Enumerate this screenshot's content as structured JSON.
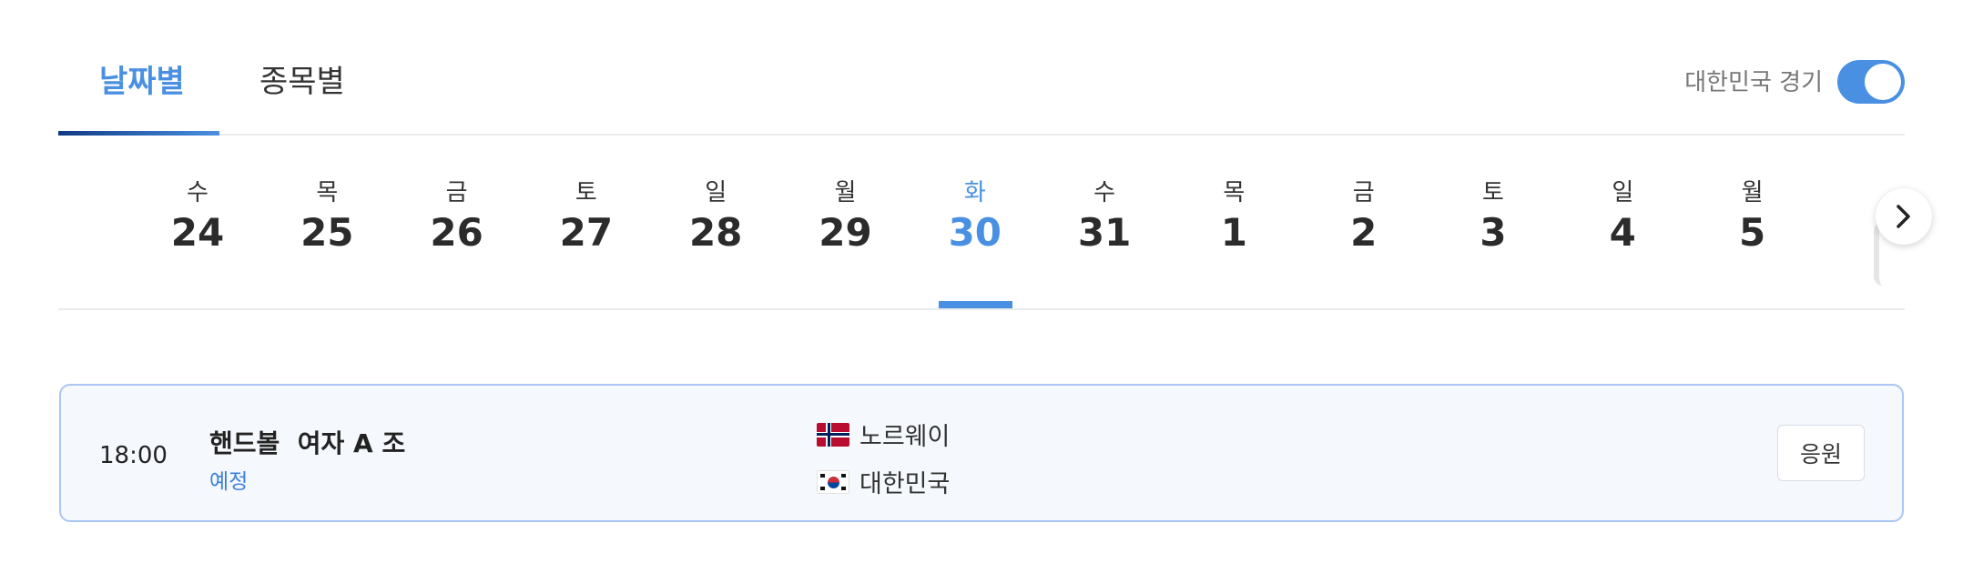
{
  "tabs": [
    {
      "label": "날짜별",
      "active": true
    },
    {
      "label": "종목별",
      "active": false
    }
  ],
  "korea_filter": {
    "label": "대한민국 경기",
    "enabled": true
  },
  "dates": [
    {
      "dow": "수",
      "day": "24"
    },
    {
      "dow": "목",
      "day": "25"
    },
    {
      "dow": "금",
      "day": "26"
    },
    {
      "dow": "토",
      "day": "27"
    },
    {
      "dow": "일",
      "day": "28"
    },
    {
      "dow": "월",
      "day": "29"
    },
    {
      "dow": "화",
      "day": "30",
      "selected": true
    },
    {
      "dow": "수",
      "day": "31"
    },
    {
      "dow": "목",
      "day": "1"
    },
    {
      "dow": "금",
      "day": "2"
    },
    {
      "dow": "토",
      "day": "3"
    },
    {
      "dow": "일",
      "day": "4"
    },
    {
      "dow": "월",
      "day": "5"
    }
  ],
  "next_icon": "chevron-right-icon",
  "colors": {
    "accent": "#4a90e2",
    "accent_dark": "#0f3a83",
    "card_bg": "#f5f8fd",
    "card_border": "#aac6f2"
  },
  "match": {
    "time": "18:00",
    "title": "핸드볼  여자 A 조",
    "status": "예정",
    "teams": [
      {
        "name": "노르웨이",
        "flag": "norway-flag-icon"
      },
      {
        "name": "대한민국",
        "flag": "korea-flag-icon"
      }
    ],
    "cheer_label": "응원"
  }
}
